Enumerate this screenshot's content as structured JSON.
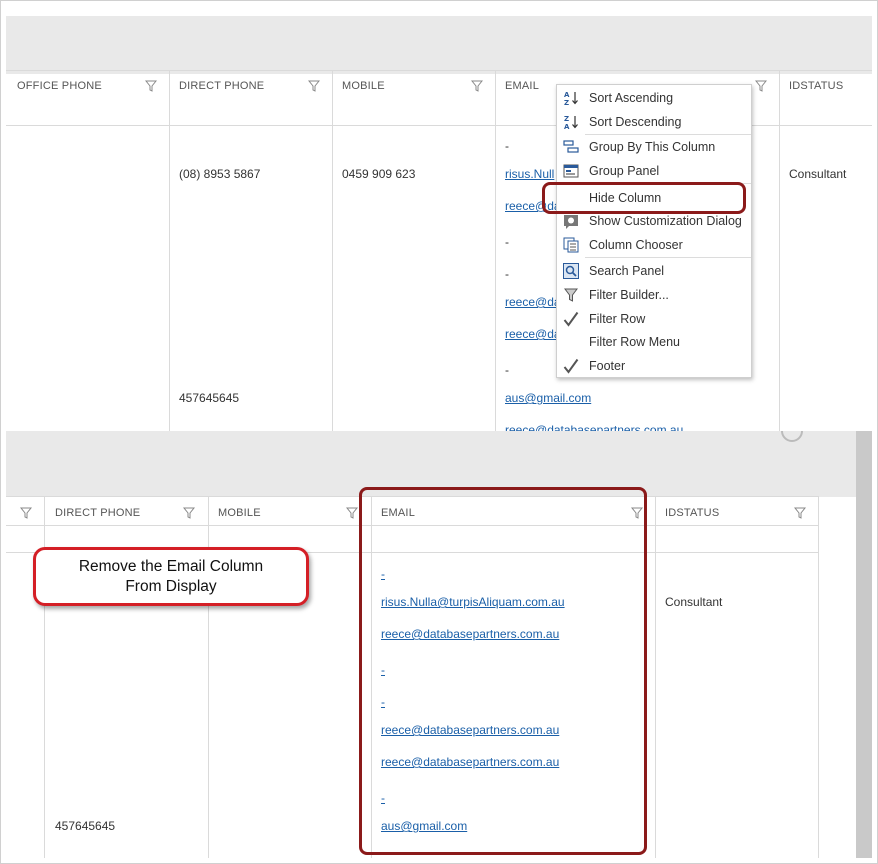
{
  "top_grid": {
    "columns": [
      "OFFICE PHONE",
      "DIRECT PHONE",
      "MOBILE",
      "EMAIL",
      "IDSTATUS"
    ],
    "row": {
      "direct_phone_1": "(08) 8953 5867",
      "direct_phone_2": "457645645",
      "mobile": "0459 909 623",
      "idstatus": "Consultant",
      "email_dash_1": "-",
      "email_link_1": "risus.Null",
      "email_link_2": "reece@da",
      "email_dash_2": "-",
      "email_dash_3": "-",
      "email_link_3": "reece@da",
      "email_link_4": "reece@da",
      "email_dash_4": "-",
      "email_link_5": "aus@gmail.com",
      "email_link_6": "reece@databasepartners.com.au"
    }
  },
  "context_menu": {
    "items": [
      {
        "label": "Sort Ascending",
        "icon": "sort-ascending-icon"
      },
      {
        "label": "Sort Descending",
        "icon": "sort-descending-icon"
      },
      {
        "label": "Group By This Column",
        "icon": "group-by-icon"
      },
      {
        "label": "Group Panel",
        "icon": "group-panel-icon"
      },
      {
        "label": "Hide Column",
        "icon": ""
      },
      {
        "label": "Show Customization Dialog",
        "icon": "customization-dialog-icon"
      },
      {
        "label": "Column Chooser",
        "icon": "column-chooser-icon"
      },
      {
        "label": "Search Panel",
        "icon": "search-panel-icon"
      },
      {
        "label": "Filter Builder...",
        "icon": "filter-builder-icon"
      },
      {
        "label": "Filter Row",
        "icon": "checkmark-icon"
      },
      {
        "label": "Filter Row Menu",
        "icon": ""
      },
      {
        "label": "Footer",
        "icon": "checkmark-icon"
      }
    ]
  },
  "bottom_grid": {
    "columns": [
      "DIRECT PHONE",
      "MOBILE",
      "EMAIL",
      "IDSTATUS"
    ],
    "row": {
      "direct_phone": "457645645",
      "idstatus": "Consultant",
      "emails": [
        "-",
        "risus.Nulla@turpisAliquam.com.au",
        "reece@databasepartners.com.au",
        "-",
        "-",
        "reece@databasepartners.com.au",
        "reece@databasepartners.com.au",
        "-",
        "aus@gmail.com"
      ]
    }
  },
  "callout": {
    "line1": "Remove the Email Column",
    "line2": "From Display"
  },
  "colors": {
    "highlight_box": "#8b1a1a",
    "callout_border": "#d41f26",
    "link": "#1a5fa8"
  }
}
